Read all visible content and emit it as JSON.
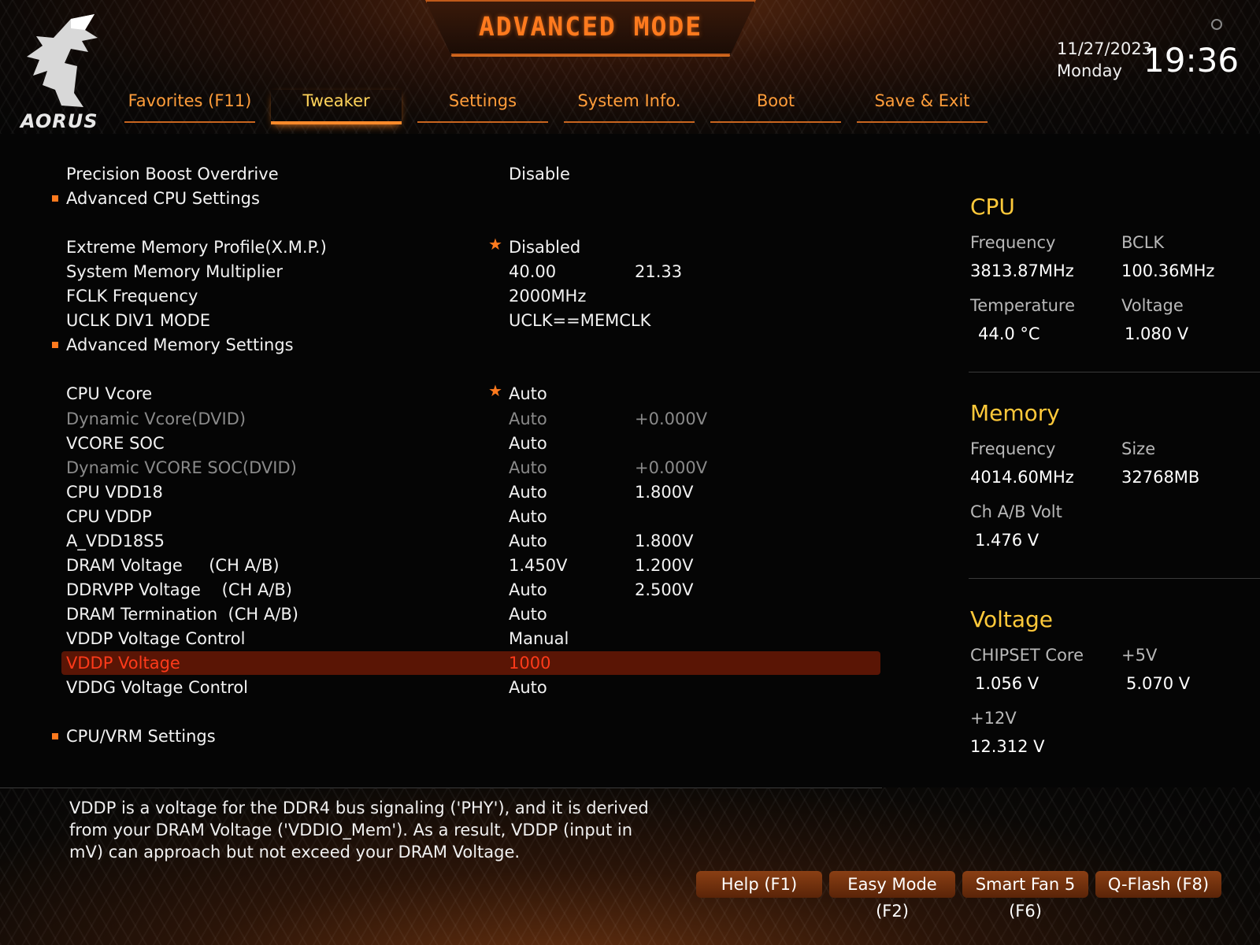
{
  "header": {
    "title": "ADVANCED MODE",
    "logo_text": "AORUS",
    "date": "11/27/2023",
    "day": "Monday",
    "time": "19:36"
  },
  "tabs": [
    {
      "label": "Favorites (F11)",
      "active": false
    },
    {
      "label": "Tweaker",
      "active": true
    },
    {
      "label": "Settings",
      "active": false
    },
    {
      "label": "System Info.",
      "active": false
    },
    {
      "label": "Boot",
      "active": false
    },
    {
      "label": "Save & Exit",
      "active": false
    }
  ],
  "settings": [
    {
      "label": "Precision Boost Overdrive",
      "value": "Disable",
      "value2": ""
    },
    {
      "label": "Advanced CPU Settings",
      "value": "",
      "value2": ""
    },
    {
      "label": "Extreme Memory Profile(X.M.P.)",
      "value": "Disabled",
      "value2": ""
    },
    {
      "label": "System Memory Multiplier",
      "value": "40.00",
      "value2": "21.33"
    },
    {
      "label": "FCLK Frequency",
      "value": "2000MHz",
      "value2": ""
    },
    {
      "label": "UCLK DIV1 MODE",
      "value": "UCLK==MEMCLK",
      "value2": ""
    },
    {
      "label": "Advanced Memory Settings",
      "value": "",
      "value2": ""
    },
    {
      "label": "CPU Vcore",
      "value": "Auto",
      "value2": ""
    },
    {
      "label": "Dynamic Vcore(DVID)",
      "value": "Auto",
      "value2": "+0.000V"
    },
    {
      "label": "VCORE SOC",
      "value": "Auto",
      "value2": ""
    },
    {
      "label": "Dynamic VCORE SOC(DVID)",
      "value": "Auto",
      "value2": "+0.000V"
    },
    {
      "label": "CPU VDD18",
      "value": "Auto",
      "value2": "1.800V"
    },
    {
      "label": "CPU VDDP",
      "value": "Auto",
      "value2": ""
    },
    {
      "label": "A_VDD18S5",
      "value": "Auto",
      "value2": "1.800V"
    },
    {
      "label": "DRAM Voltage     (CH A/B)",
      "value": "1.450V",
      "value2": "1.200V"
    },
    {
      "label": "DDRVPP Voltage    (CH A/B)",
      "value": "Auto",
      "value2": "2.500V"
    },
    {
      "label": "DRAM Termination  (CH A/B)",
      "value": "Auto",
      "value2": ""
    },
    {
      "label": "VDDP Voltage Control",
      "value": "Manual",
      "value2": ""
    },
    {
      "label": "VDDP Voltage",
      "value": "1000",
      "value2": ""
    },
    {
      "label": "VDDG Voltage Control",
      "value": "Auto",
      "value2": ""
    },
    {
      "label": "CPU/VRM Settings",
      "value": "",
      "value2": ""
    }
  ],
  "info": {
    "cpu": {
      "title": "CPU",
      "freq_label": "Frequency",
      "freq": "3813.87MHz",
      "bclk_label": "BCLK",
      "bclk": "100.36MHz",
      "temp_label": "Temperature",
      "temp": "44.0 °C",
      "volt_label": "Voltage",
      "volt": "1.080 V"
    },
    "memory": {
      "title": "Memory",
      "freq_label": "Frequency",
      "freq": "4014.60MHz",
      "size_label": "Size",
      "size": "32768MB",
      "chvolt_label": "Ch A/B Volt",
      "chvolt": "1.476 V"
    },
    "voltage": {
      "title": "Voltage",
      "chipset_label": "CHIPSET Core",
      "chipset": "1.056 V",
      "v5_label": "+5V",
      "v5": "5.070 V",
      "v12_label": "+12V",
      "v12": "12.312 V"
    }
  },
  "help_text": "VDDP is a voltage for the DDR4 bus signaling ('PHY'), and it is derived from your DRAM Voltage ('VDDIO_Mem'). As a result, VDDP (input in mV) can approach but not exceed your DRAM Voltage.",
  "function_buttons": [
    {
      "label": "Help (F1)"
    },
    {
      "label": "Easy Mode (F2)"
    },
    {
      "label": "Smart Fan 5 (F6)"
    },
    {
      "label": "Q-Flash (F8)"
    }
  ],
  "colors": {
    "accent": "#ff7a1e",
    "highlight": "#ffc93a",
    "selected_bg": "#5a1505",
    "selected_text": "#ff3a1a"
  }
}
